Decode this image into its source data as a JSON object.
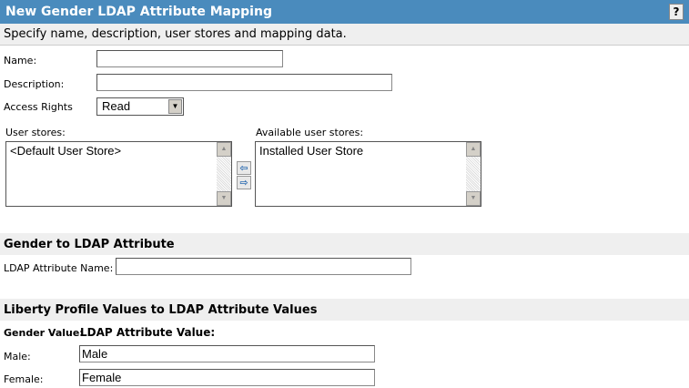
{
  "header": {
    "title": "New Gender LDAP Attribute Mapping",
    "help_label": "?"
  },
  "subtitle": "Specify name, description, user stores and mapping data.",
  "form": {
    "name_label": "Name:",
    "name_value": "",
    "description_label": "Description:",
    "description_value": "",
    "access_label": "Access Rights",
    "access_value": "Read"
  },
  "stores": {
    "user_label": "User stores:",
    "user_items": [
      "<Default User Store>"
    ],
    "available_label": "Available user stores:",
    "available_items": [
      "Installed User Store"
    ],
    "move_left": "⇦",
    "move_right": "⇨"
  },
  "gender": {
    "title": "Gender to LDAP Attribute",
    "attr_label": "LDAP Attribute Name:",
    "attr_value": ""
  },
  "liberty": {
    "title": "Liberty Profile Values to LDAP Attribute Values",
    "col1": "Gender Value:",
    "col2": "LDAP Attribute Value:",
    "male_label": "Male:",
    "male_value": "Male",
    "female_label": "Female:",
    "female_value": "Female"
  }
}
